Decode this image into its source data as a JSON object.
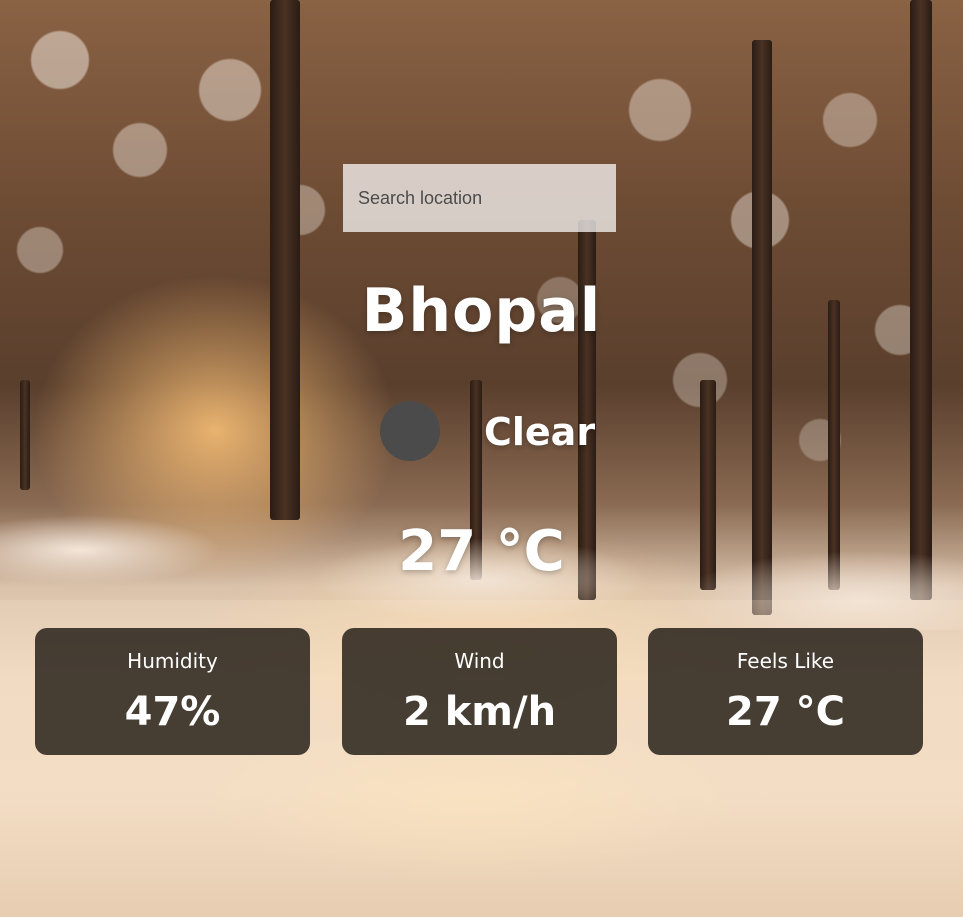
{
  "search": {
    "placeholder": "Search location",
    "value": ""
  },
  "location": {
    "city": "Bhopal"
  },
  "current": {
    "condition": "Clear",
    "icon": "weather-condition-icon",
    "temperature": "27 °C"
  },
  "details": [
    {
      "label": "Humidity",
      "value": "47%"
    },
    {
      "label": "Wind",
      "value": "2 km/h"
    },
    {
      "label": "Feels Like",
      "value": "27 °C"
    }
  ],
  "colors": {
    "text": "#ffffff",
    "card_background": "#201a14",
    "icon_placeholder": "#4b4b4b",
    "search_background": "#ffffff"
  }
}
